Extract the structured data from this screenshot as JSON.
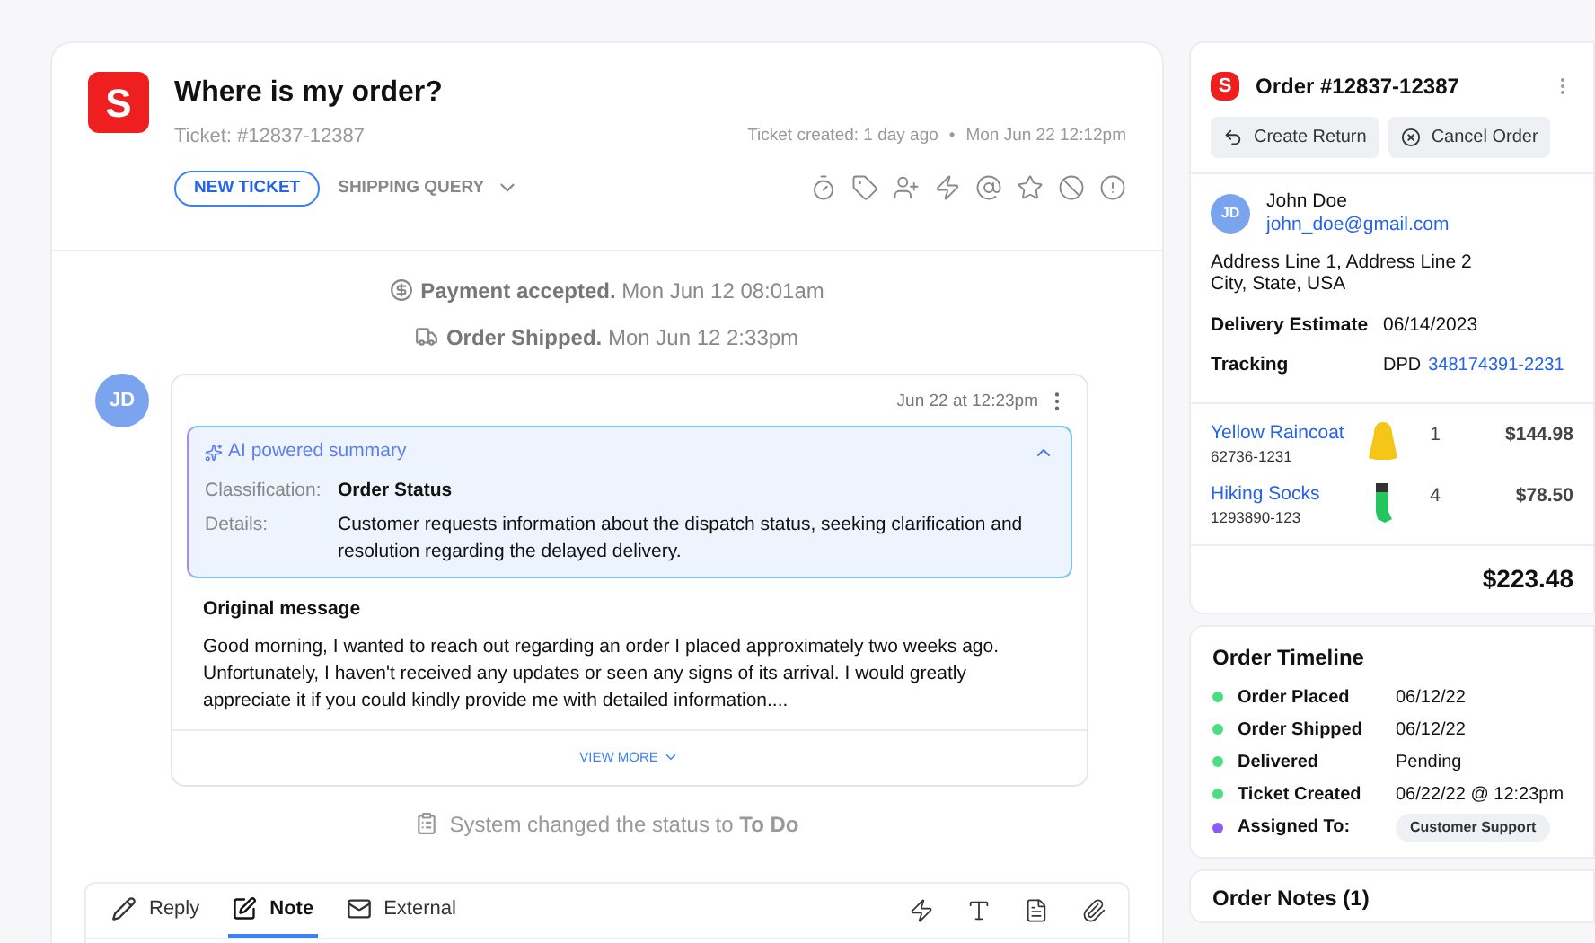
{
  "ticket": {
    "logo": "S",
    "title": "Where is my order?",
    "number": "Ticket: #12837-12387",
    "created": "Ticket created: 1 day ago",
    "separator": "•",
    "date": "Mon Jun 22 12:12pm",
    "status": "NEW TICKET",
    "category": "SHIPPING QUERY"
  },
  "events": [
    {
      "kind": "payment",
      "bold": "Payment accepted.",
      "text": "Mon Jun 12 08:01am"
    },
    {
      "kind": "shipped",
      "bold": "Order Shipped.",
      "text": "Mon Jun 12 2:33pm"
    }
  ],
  "message": {
    "avatar": "JD",
    "time": "Jun 22 at 12:23pm",
    "summary": {
      "title": "AI powered summary",
      "expanded": true,
      "classification_label": "Classification:",
      "classification": "Order Status",
      "details_label": "Details:",
      "details": "Customer requests information about the dispatch status, seeking clarification and resolution regarding the delayed delivery."
    },
    "original_title": "Original message",
    "original": "Good morning, I wanted to reach out regarding an order I placed approximately two weeks ago. Unfortunately, I haven't received any updates or seen any signs of its arrival. I would greatly appreciate it if you could kindly provide me with detailed information....",
    "view_more": "VIEW MORE"
  },
  "status_change": "System changed the status to **To Do**",
  "composer": {
    "tabs": [
      {
        "kind": "reply",
        "label": "Reply",
        "selected": false
      },
      {
        "kind": "note",
        "label": "Note",
        "selected": true
      },
      {
        "kind": "external",
        "label": "External",
        "selected": false
      }
    ]
  },
  "order": {
    "logo": "S",
    "title": "Order #12837-12387",
    "actions": [
      {
        "kind": "return",
        "label": "Create Return"
      },
      {
        "kind": "cancel",
        "label": "Cancel Order"
      }
    ],
    "customer": {
      "avatar": "JD",
      "name": "John Doe",
      "email": "john_doe@gmail.com",
      "address_1": "Address Line 1, Address Line 2",
      "address_2": "City, State, USA"
    },
    "delivery_label": "Delivery Estimate",
    "delivery": "06/14/2023",
    "tracking_label": "Tracking",
    "carrier": "DPD",
    "tracking": "348174391-2231",
    "items": [
      {
        "kind": "raincoat",
        "name": "Yellow Raincoat",
        "sku": "62736-1231",
        "qty": "1",
        "price": "$144.98"
      },
      {
        "kind": "socks",
        "name": "Hiking Socks",
        "sku": "1293890-123",
        "qty": "4",
        "price": "$78.50"
      }
    ],
    "total": "$223.48"
  },
  "timeline": {
    "title": "Order Timeline",
    "items": [
      {
        "kind": "text",
        "label": "Order Placed",
        "value": "06/12/22",
        "color": "#4ade80"
      },
      {
        "kind": "text",
        "label": "Order Shipped",
        "value": "06/12/22",
        "color": "#4ade80"
      },
      {
        "kind": "text",
        "label": "Delivered",
        "value": "Pending",
        "color": "#4ade80"
      },
      {
        "kind": "text",
        "label": "Ticket Created",
        "value": "06/22/22 @ 12:23pm",
        "color": "#4ade80"
      },
      {
        "kind": "badge",
        "label": "Assigned To:",
        "value": "Customer Support",
        "color": "#8b5cf6"
      }
    ]
  },
  "notes": {
    "title": "Order Notes (1)"
  }
}
